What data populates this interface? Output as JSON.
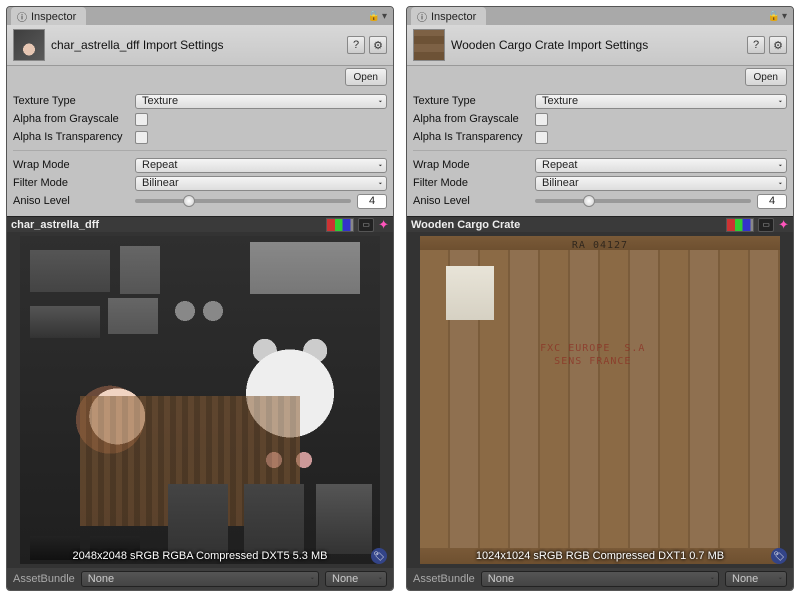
{
  "panels": [
    {
      "tab_label": "Inspector",
      "title": "char_astrella_dff Import Settings",
      "open_label": "Open",
      "fields": {
        "texture_type_label": "Texture Type",
        "texture_type_value": "Texture",
        "alpha_grayscale_label": "Alpha from Grayscale",
        "alpha_transparency_label": "Alpha Is Transparency",
        "wrap_mode_label": "Wrap Mode",
        "wrap_mode_value": "Repeat",
        "filter_mode_label": "Filter Mode",
        "filter_mode_value": "Bilinear",
        "aniso_label": "Aniso Level",
        "aniso_value": "4"
      },
      "preview_title": "char_astrella_dff",
      "preview_info": "2048x2048 sRGB  RGBA Compressed DXT5   5.3 MB",
      "footer_label": "AssetBundle",
      "footer_value1": "None",
      "footer_value2": "None"
    },
    {
      "tab_label": "Inspector",
      "title": "Wooden Cargo Crate Import Settings",
      "open_label": "Open",
      "fields": {
        "texture_type_label": "Texture Type",
        "texture_type_value": "Texture",
        "alpha_grayscale_label": "Alpha from Grayscale",
        "alpha_transparency_label": "Alpha Is Transparency",
        "wrap_mode_label": "Wrap Mode",
        "wrap_mode_value": "Repeat",
        "filter_mode_label": "Filter Mode",
        "filter_mode_value": "Bilinear",
        "aniso_label": "Aniso Level",
        "aniso_value": "4"
      },
      "preview_title": "Wooden Cargo Crate",
      "preview_info": "1024x1024 sRGB  RGB Compressed DXT1   0.7 MB",
      "crate_stamp_top": "RA  04127",
      "crate_stamp_mid": "FXC EUROPE  S.A\nSENS FRANCE",
      "footer_label": "AssetBundle",
      "footer_value1": "None",
      "footer_value2": "None"
    }
  ]
}
